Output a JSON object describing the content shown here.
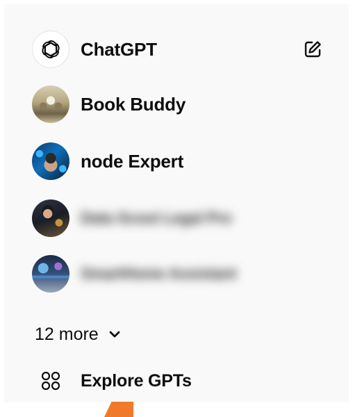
{
  "sidebar": {
    "items": [
      {
        "label": "ChatGPT",
        "icon": "openai-logo-icon"
      },
      {
        "label": "Book Buddy",
        "icon": "book-buddy-avatar"
      },
      {
        "label": "node Expert",
        "icon": "node-expert-avatar"
      },
      {
        "label": "Data Scout Legal Pro",
        "icon": "legal-avatar",
        "blurred": true
      },
      {
        "label": "SmartHome Assistant",
        "icon": "home-avatar",
        "blurred": true
      }
    ],
    "more_label": "12 more",
    "explore_label": "Explore GPTs",
    "new_chat_icon": "edit-icon"
  },
  "colors": {
    "panel_bg": "#f9f9f9",
    "text": "#0d0d0d",
    "accent_orange": "#f07a2a"
  }
}
